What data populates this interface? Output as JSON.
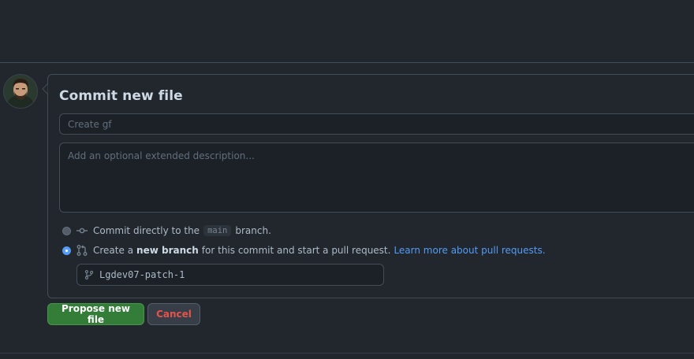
{
  "commit": {
    "title": "Commit new file",
    "summary_placeholder": "Create gf",
    "summary_value": "",
    "description_placeholder": "Add an optional extended description...",
    "description_value": ""
  },
  "options": {
    "direct": {
      "prefix": "Commit directly to the",
      "branch_tag": "main",
      "suffix": "branch.",
      "selected": false
    },
    "new_branch": {
      "prefix": "Create a",
      "strong": "new branch",
      "suffix": "for this commit and start a pull request.",
      "link": "Learn more about pull requests.",
      "selected": true
    }
  },
  "branch_name": "Lgdev07-patch-1",
  "actions": {
    "propose_label": "Propose new file",
    "cancel_label": "Cancel"
  },
  "colors": {
    "accent_blue": "#539bf5",
    "primary_green": "#347d39",
    "danger_red": "#e5534b",
    "background": "#22272e"
  },
  "icons": {
    "commit": "git-commit-icon",
    "pull_request": "git-pull-request-icon",
    "branch": "git-branch-icon"
  }
}
